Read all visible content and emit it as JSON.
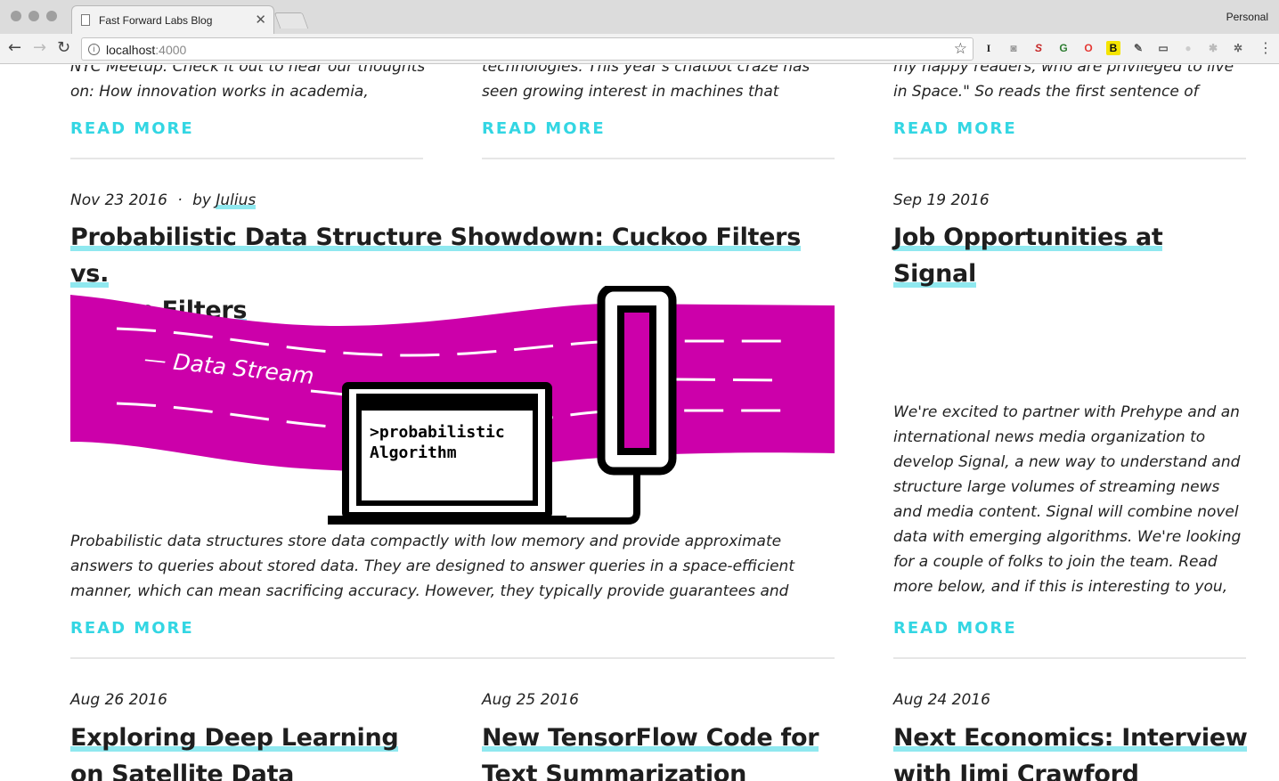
{
  "browser": {
    "tab_title": "Fast Forward Labs Blog",
    "profile": "Personal",
    "url_host": "localhost",
    "url_port": ":4000"
  },
  "top_row": [
    {
      "teaser_line1": "NYC Meetup. Check it out to hear our thoughts",
      "teaser_line2": "on: How innovation works in academia,",
      "read_more": "READ MORE"
    },
    {
      "teaser_line1": "technologies. This year's chatbot craze has",
      "teaser_line2": "seen growing interest in machines that",
      "read_more": "READ MORE"
    },
    {
      "teaser_line1": "my happy readers, who are privileged to live",
      "teaser_line2": "in Space.\" So reads the first sentence of",
      "read_more": "READ MORE"
    }
  ],
  "featured": {
    "date": "Nov 23 2016",
    "separator": "·",
    "by": "by",
    "author": "Julius",
    "title_line1": "Probabilistic Data Structure Showdown: Cuckoo Filters vs.",
    "title_line2": "Bloom Filters",
    "image_text": {
      "stream_label": "— Data Stream",
      "screen_line1": ">probabilistic",
      "screen_line2": "Algorithm"
    },
    "excerpt_lines": [
      "Probabilistic data structures store data compactly with low memory and provide approximate",
      "answers to queries about stored data. They are designed to answer queries in a space-efficient",
      "manner, which can mean sacrificing accuracy. However, they typically provide guarantees and"
    ],
    "read_more": "READ MORE"
  },
  "side_post": {
    "date": "Sep 19 2016",
    "title_line1": "Job Opportunities at",
    "title_line2": "Signal",
    "excerpt_lines": [
      "We're excited to partner with Prehype and an",
      "international news media organization to",
      "develop Signal, a new way to understand and",
      "structure large volumes of streaming news",
      "and media content. Signal will combine novel",
      "data with emerging algorithms. We're looking",
      "for a couple of folks to join the team. Read",
      "more below, and if this is interesting to you,"
    ],
    "read_more": "READ MORE"
  },
  "bottom_row": [
    {
      "date": "Aug 26 2016",
      "title_line1": "Exploring Deep Learning",
      "title_line2": "on Satellite Data"
    },
    {
      "date": "Aug 25 2016",
      "title_line1": "New TensorFlow Code for",
      "title_line2": "Text Summarization"
    },
    {
      "date": "Aug 24 2016",
      "title_line1": "Next Economics: Interview",
      "title_line2": "with Jimi Crawford"
    }
  ],
  "colors": {
    "accent": "#33d6e3",
    "highlight": "#8fe8ef",
    "magenta": "#cc00aa"
  }
}
